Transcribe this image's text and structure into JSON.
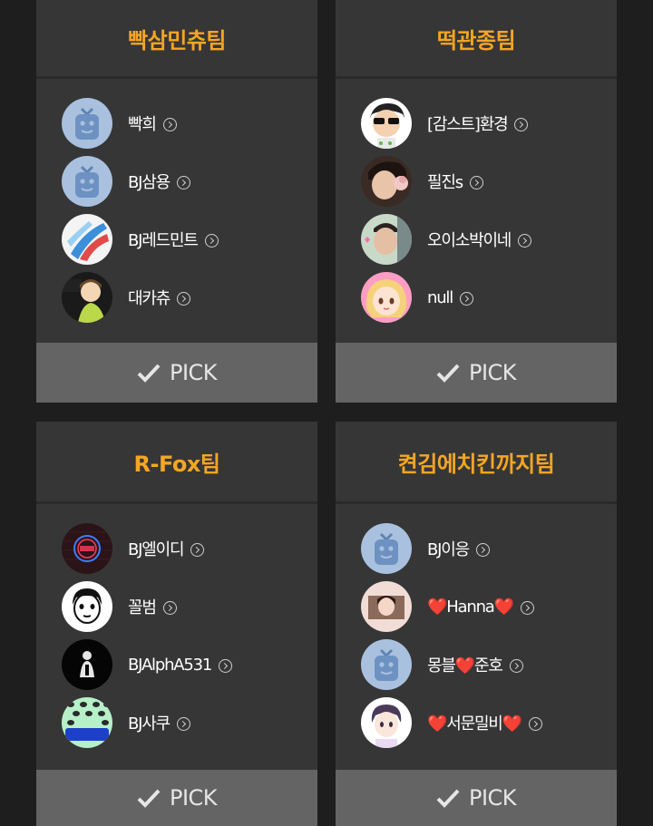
{
  "teams": [
    {
      "name": "빡삼민츄팀",
      "members": [
        {
          "name": "빡희",
          "avatar": "default-tv-avatar"
        },
        {
          "name": "BJ삼용",
          "avatar": "default-tv-avatar"
        },
        {
          "name": "BJ레드민트",
          "avatar": "abstract-paint-avatar"
        },
        {
          "name": "대카츄",
          "avatar": "cartoon-character-avatar"
        }
      ],
      "pick_label": "PICK"
    },
    {
      "name": "떡관종팀",
      "members": [
        {
          "name": "[감스트]환경",
          "avatar": "cartoon-sunglasses-avatar"
        },
        {
          "name": "필진s",
          "avatar": "photo-avatar"
        },
        {
          "name": "오이소박이네",
          "avatar": "photo-avatar"
        },
        {
          "name": "null",
          "avatar": "anime-girl-avatar"
        }
      ],
      "pick_label": "PICK"
    },
    {
      "name": "R-Fox팀",
      "members": [
        {
          "name": "BJ엘이디",
          "avatar": "neon-open-sign-avatar"
        },
        {
          "name": "꼴범",
          "avatar": "cartoon-face-avatar"
        },
        {
          "name": "BJAlphA531",
          "avatar": "dark-figure-avatar"
        },
        {
          "name": "BJ사쿠",
          "avatar": "bj-saku-logo-avatar"
        }
      ],
      "pick_label": "PICK"
    },
    {
      "name": "켠김에치킨까지팀",
      "members": [
        {
          "name": "BJ이응",
          "avatar": "default-tv-avatar"
        },
        {
          "name_parts": [
            "❤️",
            "Hanna",
            "❤️"
          ],
          "name": "❤️Hanna❤️",
          "avatar": "photo-avatar"
        },
        {
          "name_parts": [
            "몽블",
            "❤️",
            "준호"
          ],
          "name": "몽블❤️준호",
          "avatar": "default-tv-avatar"
        },
        {
          "name_parts": [
            "❤️",
            "서문밀비",
            "❤️"
          ],
          "name": "❤️서문밀비❤️",
          "avatar": "anime-boy-avatar"
        }
      ],
      "pick_label": "PICK"
    }
  ],
  "colors": {
    "background": "#1e1e1e",
    "card": "#363636",
    "team_title": "#f5a623",
    "pick_button": "#646464",
    "heart": "#e02424"
  }
}
